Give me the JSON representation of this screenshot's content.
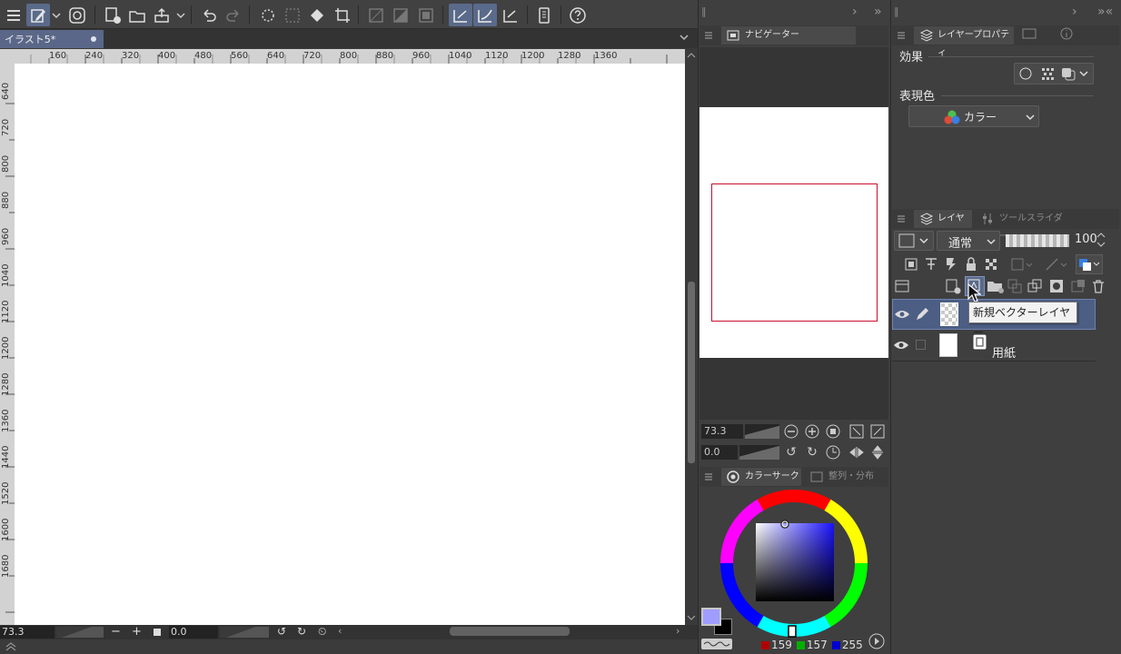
{
  "document": {
    "tab_title": "イラスト5*"
  },
  "ruler": {
    "h_labels": [
      "160",
      "240",
      "320",
      "400",
      "480",
      "560",
      "640",
      "720",
      "800",
      "880",
      "960",
      "1040",
      "1120",
      "1200",
      "1280",
      "1360"
    ],
    "v_labels": [
      "640",
      "720",
      "800",
      "880",
      "960",
      "1040",
      "1120",
      "1200",
      "1280",
      "1360",
      "1440",
      "1520",
      "1600",
      "1680"
    ]
  },
  "status": {
    "zoom": "73.3",
    "rotation": "0.0"
  },
  "navigator": {
    "tab_label": "ナビゲーター",
    "zoom": "73.3",
    "rotation": "0.0",
    "frame_color": "#c8102e"
  },
  "layer_property": {
    "tab_label": "レイヤープロパティ",
    "effect_label": "効果",
    "expression_label": "表現色",
    "expression_value": "カラー"
  },
  "layers_panel": {
    "tab_layer": "レイヤー",
    "tab_tool_slider": "ツールスライダー",
    "blend_mode": "通常",
    "opacity": "100",
    "tooltip": "新規ベクターレイヤー",
    "layers": [
      {
        "name": "",
        "selected": true,
        "type": "raster"
      },
      {
        "name": "用紙",
        "selected": false,
        "type": "paper"
      }
    ]
  },
  "color": {
    "tab_color_circle": "カラーサークル",
    "tab_align": "整列・分布",
    "r": "159",
    "g": "157",
    "b": "255",
    "main_color": "#9f9dff",
    "sub_color": "#000000"
  },
  "theme": {
    "accent": "#5a6788",
    "selection": "#5a6a8a"
  }
}
